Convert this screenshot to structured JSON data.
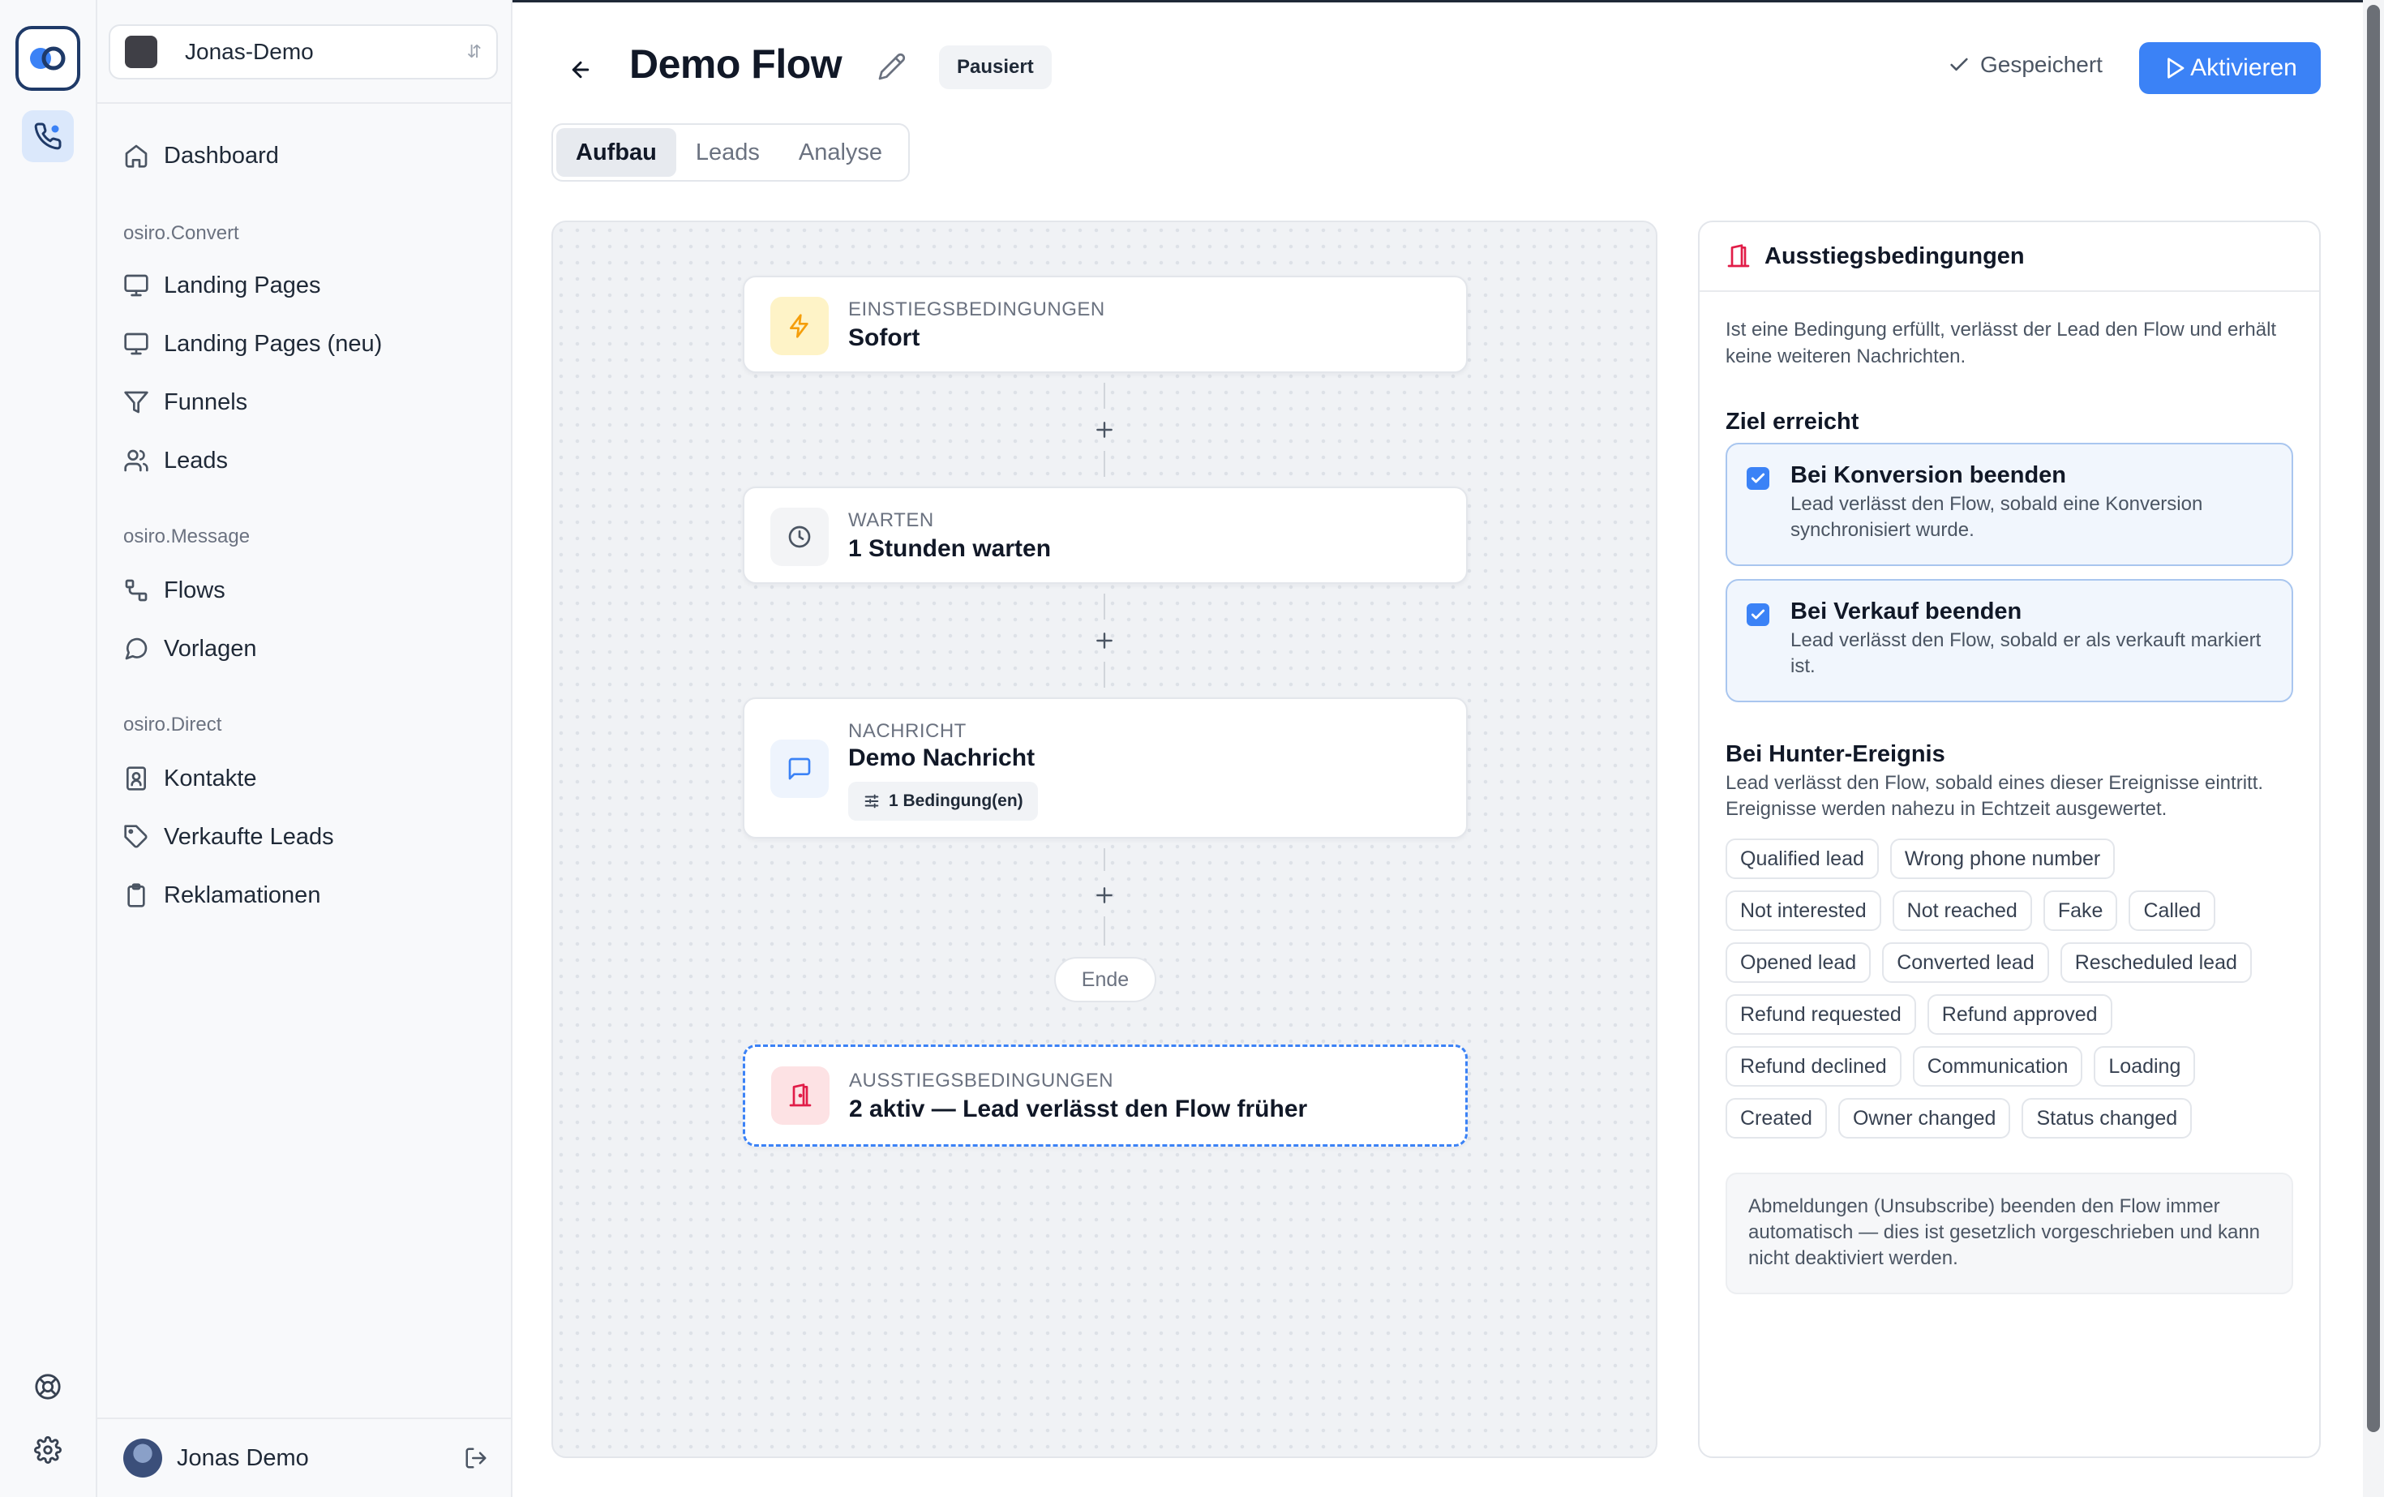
{
  "workspace": {
    "name": "Jonas-Demo"
  },
  "nav": {
    "dashboard": "Dashboard",
    "sections": [
      {
        "title": "osiro.Convert",
        "items": [
          "Landing Pages",
          "Landing Pages (neu)",
          "Funnels",
          "Leads"
        ]
      },
      {
        "title": "osiro.Message",
        "items": [
          "Flows",
          "Vorlagen"
        ]
      },
      {
        "title": "osiro.Direct",
        "items": [
          "Kontakte",
          "Verkaufte Leads",
          "Reklamationen"
        ]
      }
    ]
  },
  "user": {
    "name": "Jonas Demo"
  },
  "header": {
    "title": "Demo Flow",
    "status": "Pausiert",
    "saved": "Gespeichert",
    "activate": "Aktivieren"
  },
  "tabs": [
    "Aufbau",
    "Leads",
    "Analyse"
  ],
  "flow": {
    "nodes": [
      {
        "kicker": "EINSTIEGSBEDINGUNGEN",
        "title": "Sofort"
      },
      {
        "kicker": "WARTEN",
        "title": "1 Stunden warten"
      },
      {
        "kicker": "NACHRICHT",
        "title": "Demo Nachricht",
        "chip": "1 Bedingung(en)"
      }
    ],
    "end": "Ende",
    "exit": {
      "kicker": "AUSSTIEGSBEDINGUNGEN",
      "title": "2 aktiv — Lead verlässt den Flow früher"
    }
  },
  "panel": {
    "title": "Ausstiegsbedingungen",
    "intro": "Ist eine Bedingung erfüllt, verlässt der Lead den Flow und erhält keine weiteren Nachrichten.",
    "goal_title": "Ziel erreicht",
    "checkboxes": [
      {
        "title": "Bei Konversion beenden",
        "desc": "Lead verlässt den Flow, sobald eine Konversion synchronisiert wurde.",
        "checked": true
      },
      {
        "title": "Bei Verkauf beenden",
        "desc": "Lead verlässt den Flow, sobald er als verkauft markiert ist.",
        "checked": true
      }
    ],
    "hunter_title": "Bei Hunter-Ereignis",
    "hunter_desc": "Lead verlässt den Flow, sobald eines dieser Ereignisse eintritt. Ereignisse werden nahezu in Echtzeit ausgewertet.",
    "event_rows": [
      [
        "Qualified lead",
        "Wrong phone number"
      ],
      [
        "Not interested",
        "Not reached",
        "Fake",
        "Called"
      ],
      [
        "Opened lead",
        "Converted lead",
        "Rescheduled lead"
      ],
      [
        "Refund requested",
        "Refund approved"
      ],
      [
        "Refund declined",
        "Communication",
        "Loading"
      ],
      [
        "Created",
        "Owner changed",
        "Status changed"
      ]
    ],
    "note": "Abmeldungen (Unsubscribe) beenden den Flow immer automatisch — dies ist gesetzlich vorgeschrieben und kann nicht deaktiviert werden."
  },
  "colors": {
    "accent": "#3b82f6",
    "exit_red": "#e11d48",
    "trigger_amber": "#f59e0b"
  }
}
